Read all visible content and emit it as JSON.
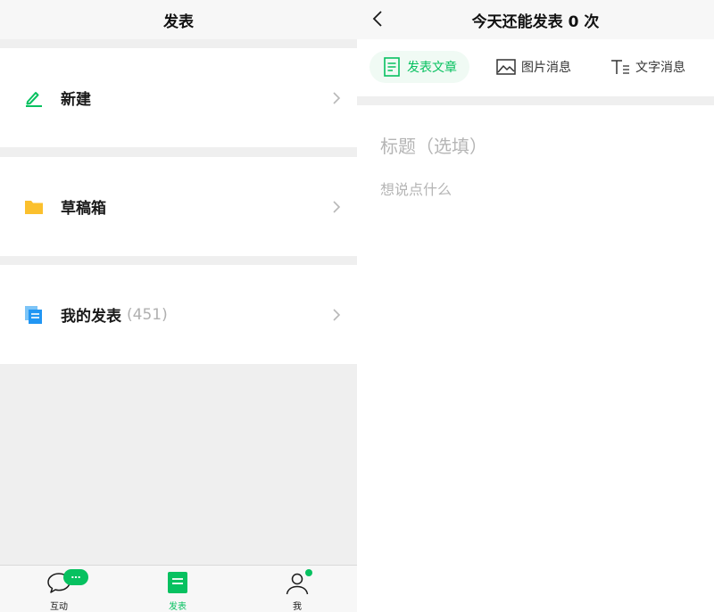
{
  "left": {
    "header_title": "发表",
    "rows": [
      {
        "label": "新建",
        "icon": "pencil-icon",
        "count": ""
      },
      {
        "label": "草稿箱",
        "icon": "folder-icon",
        "count": ""
      },
      {
        "label": "我的发表",
        "icon": "documents-icon",
        "count": "(451)"
      }
    ],
    "tabs": [
      {
        "label": "互动",
        "icon": "chat-bubble-icon",
        "badge": "…",
        "active": false
      },
      {
        "label": "发表",
        "icon": "publish-icon",
        "active": true
      },
      {
        "label": "我",
        "icon": "person-icon",
        "dot": true,
        "active": false
      }
    ]
  },
  "right": {
    "header_title": "今天还能发表 0 次",
    "segments": [
      {
        "label": "发表文章",
        "icon": "article-icon",
        "active": true
      },
      {
        "label": "图片消息",
        "icon": "image-icon",
        "active": false
      },
      {
        "label": "文字消息",
        "icon": "text-icon",
        "active": false
      }
    ],
    "title_placeholder": "标题（选填）",
    "body_placeholder": "想说点什么"
  },
  "colors": {
    "accent": "#07c160",
    "folder": "#fbc02d",
    "documents": "#2196f3",
    "background": "#efefef",
    "placeholder": "#b5b5b5"
  }
}
